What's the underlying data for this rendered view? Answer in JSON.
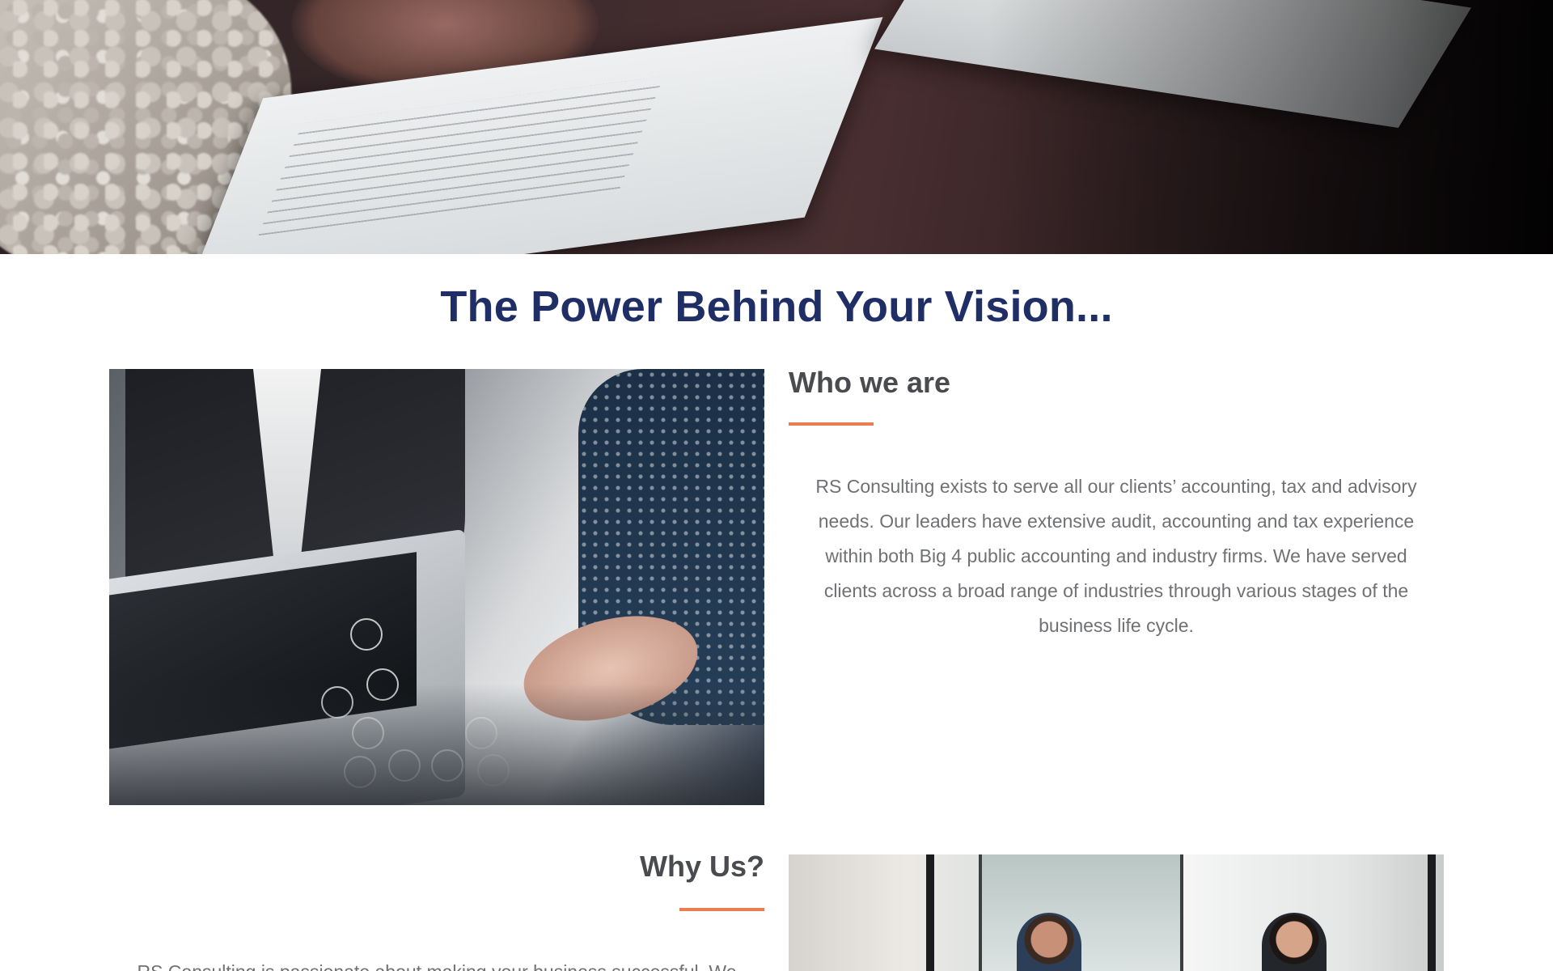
{
  "hero": {
    "image_alt": "hands reviewing documents on a wooden table"
  },
  "headline": "The Power Behind Your Vision...",
  "about": {
    "title": "Who we are",
    "body": "RS Consulting exists to serve all our clients’ accounting, tax and advisory needs. Our leaders have extensive audit, accounting and tax experience within both Big 4 public accounting and industry firms. We have served clients across a broad range of industries through various stages of the business life cycle.",
    "image_alt": "business people with laptop and digital icons"
  },
  "why": {
    "title": "Why Us?",
    "body_partial": "RS Consulting is passionate about making your business successful. We",
    "image_alt": "two men talking in a glass office"
  },
  "colors": {
    "headline": "#1f2f66",
    "heading": "#4a4b4e",
    "body": "#707174",
    "accent": "#e97d51"
  }
}
